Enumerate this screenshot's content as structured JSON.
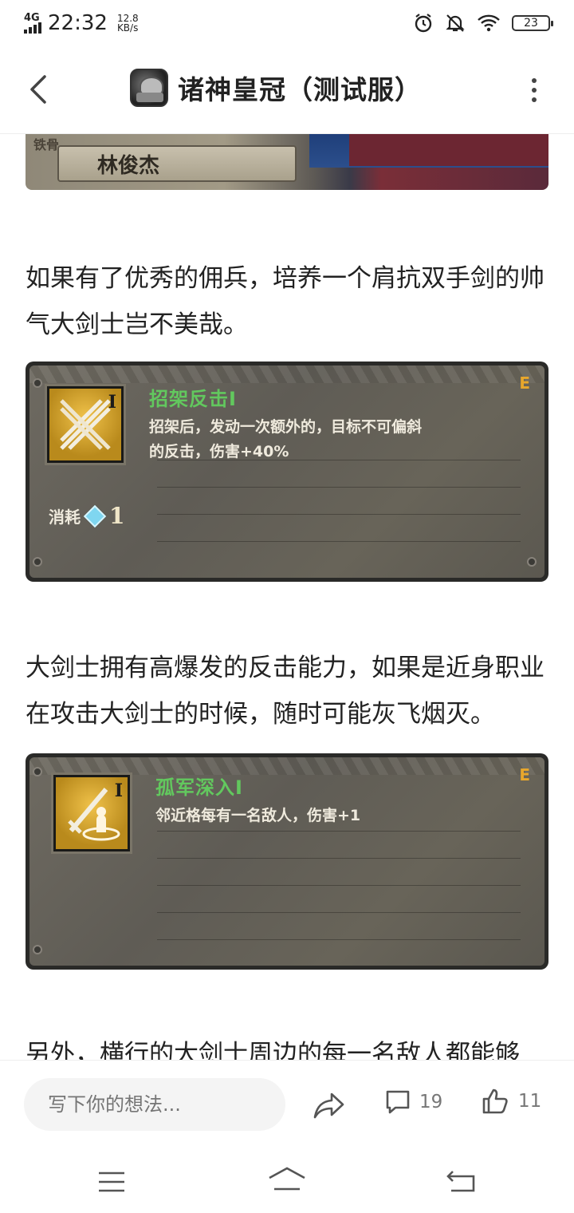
{
  "status_bar": {
    "network": "4G",
    "time": "22:32",
    "speed_value": "12.8",
    "speed_unit": "KB/s",
    "battery": "23"
  },
  "header": {
    "title": "诸神皇冠（测试服）"
  },
  "banner": {
    "tag": "铁骨",
    "name": "林俊杰"
  },
  "paragraphs": [
    "如果有了优秀的佣兵，培养一个肩抗双手剑的帅气大剑士岂不美哉。",
    "大剑士拥有高爆发的反击能力，如果是近身职业在攻击大剑士的时候，随时可能灰飞烟灭。",
    "另外，横行的大剑士周边的每一名敌人都能够"
  ],
  "skills": [
    {
      "name": "招架反击I",
      "rank": "I",
      "grade": "E",
      "desc_line1": "招架后，发动一次额外的，目标不可偏斜",
      "desc_line2": "的反击，伤害+40%",
      "cost_label": "消耗",
      "cost_value": "1"
    },
    {
      "name": "孤军深入I",
      "rank": "I",
      "grade": "E",
      "desc_line1": "邻近格每有一名敌人，伤害+1"
    }
  ],
  "bottom_bar": {
    "comment_placeholder": "写下你的想法...",
    "comment_count": "19",
    "like_count": "11"
  },
  "icons": {
    "back": "chevron-left-icon",
    "more": "more-vertical-icon",
    "share": "share-icon",
    "comment": "comment-icon",
    "like": "thumbs-up-icon"
  }
}
